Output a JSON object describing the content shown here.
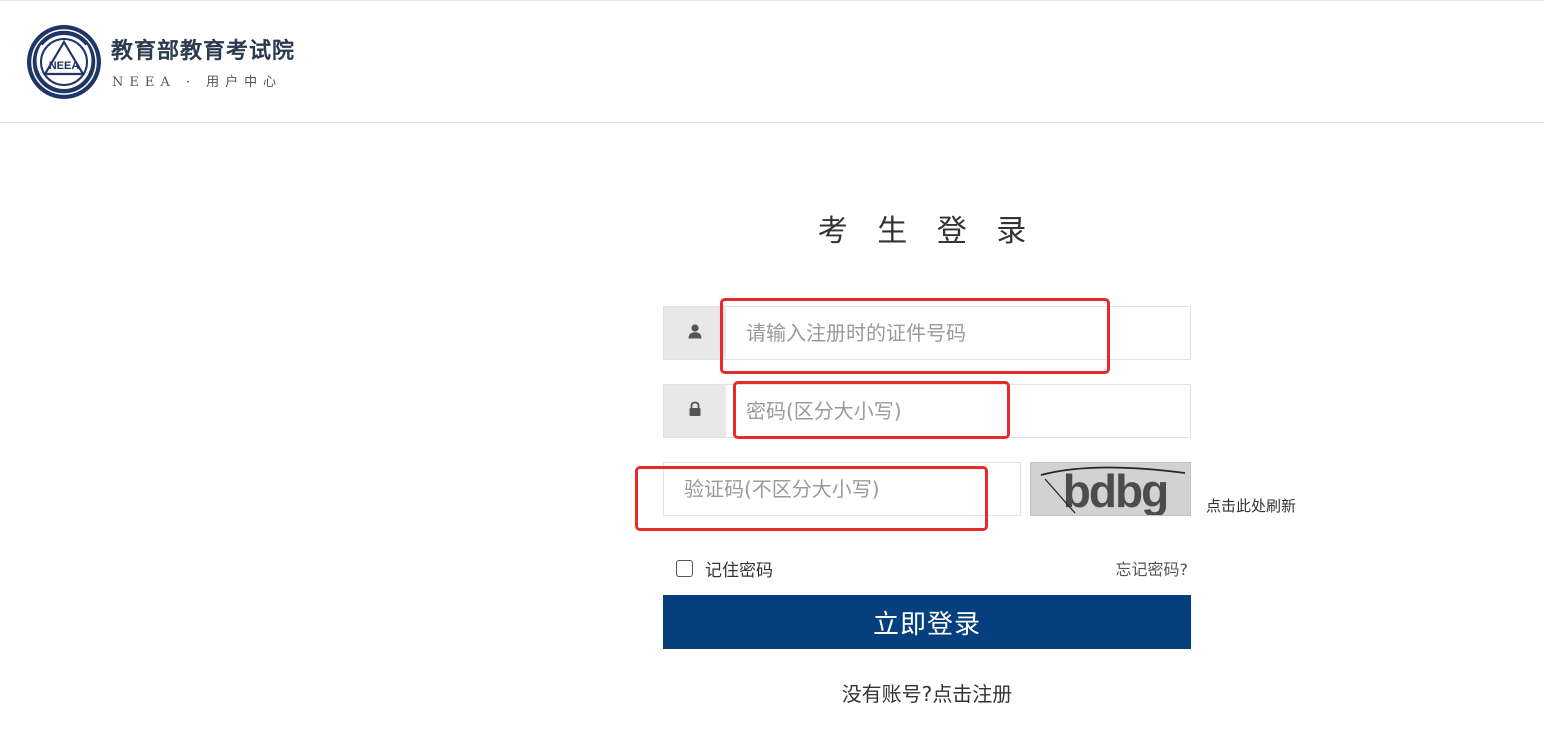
{
  "header": {
    "org_name": "教育部教育考试院",
    "subtitle": "NEEA · 用户中心",
    "logo_icon": "neea-emblem-icon",
    "logo_text": "NEEA"
  },
  "login": {
    "title": "考 生 登 录",
    "username": {
      "icon": "user-icon",
      "placeholder": "请输入注册时的证件号码",
      "value": ""
    },
    "password": {
      "icon": "lock-icon",
      "placeholder": "密码(区分大小写)",
      "value": ""
    },
    "captcha": {
      "placeholder": "验证码(不区分大小写)",
      "value": "",
      "image_text": "bdbg",
      "refresh_label": "点击此处刷新"
    },
    "remember_label": "记住密码",
    "remember_checked": false,
    "forgot_label": "忘记密码?",
    "submit_label": "立即登录",
    "register_prefix": "没有账号?",
    "register_link": "点击注册"
  },
  "colors": {
    "primary_button": "#063f7e",
    "annotation_highlight": "#e82a2a",
    "addon_background": "#e8e8e8"
  }
}
